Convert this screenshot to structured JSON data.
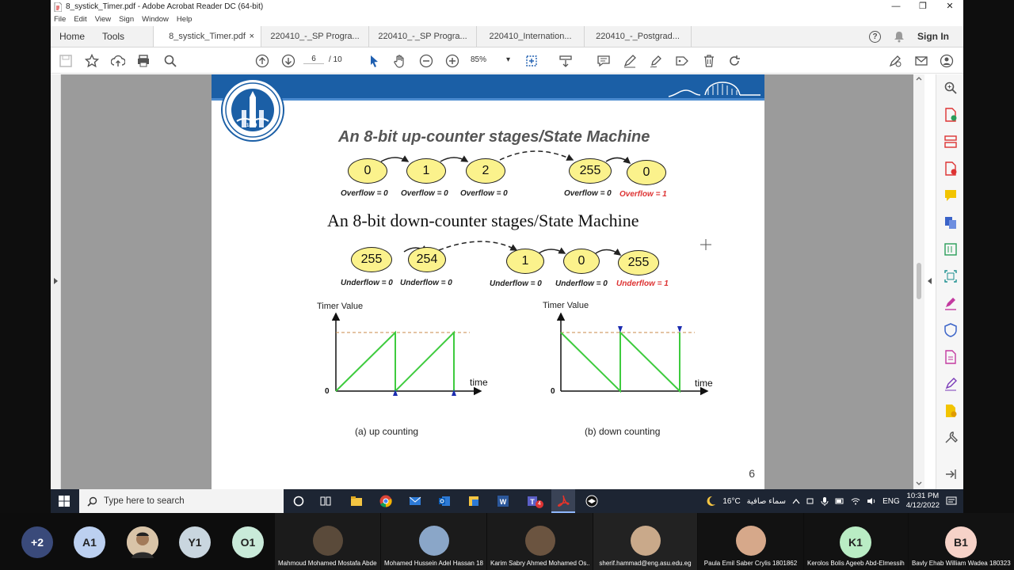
{
  "window": {
    "title": "8_systick_Timer.pdf - Adobe Acrobat Reader DC (64-bit)",
    "menu": [
      "File",
      "Edit",
      "View",
      "Sign",
      "Window",
      "Help"
    ]
  },
  "tabs": {
    "home": "Home",
    "tools": "Tools",
    "docs": [
      {
        "label": "8_systick_Timer.pdf"
      },
      {
        "label": "220410_-_SP Progra..."
      },
      {
        "label": "220410_-_SP Progra..."
      },
      {
        "label": "220410_Internation..."
      },
      {
        "label": "220410_-_Postgrad..."
      }
    ],
    "close": "×",
    "sign_in": "Sign In",
    "help": "?"
  },
  "toolbar": {
    "page_current": "6",
    "page_total": "/ 10",
    "zoom": "85%",
    "zoom_caret": "▾"
  },
  "slide": {
    "up_title": "An 8-bit up-counter stages/State Machine",
    "up_states": [
      "0",
      "1",
      "2",
      "255",
      "0"
    ],
    "up_flags": [
      "Overflow = 0",
      "Overflow = 0",
      "Overflow = 0",
      "Overflow = 0",
      "Overflow = 1"
    ],
    "down_title": "An 8-bit down-counter stages/State Machine",
    "down_states": [
      "255",
      "254",
      "1",
      "0",
      "255"
    ],
    "down_flags": [
      "Underflow = 0",
      "Underflow = 0",
      "Underflow = 0",
      "Underflow = 0",
      "Underflow = 1"
    ],
    "logo_year": "1839",
    "page_number": "6",
    "charts": [
      {
        "ylabel": "Timer Value",
        "zero": "0",
        "xlabel": "time",
        "caption": "(a) up counting"
      },
      {
        "ylabel": "Timer Value",
        "zero": "0",
        "xlabel": "time",
        "caption": "(b) down counting"
      }
    ]
  },
  "taskbar": {
    "search_placeholder": "Type here to search",
    "teams_badge": "4",
    "weather": "16°C",
    "weather_text": "سماء صافية",
    "lang": "ENG",
    "time": "10:31 PM",
    "date": "4/12/2022"
  },
  "meeting": {
    "avatars": [
      {
        "initials": "+2",
        "color": "#3a4a7a"
      },
      {
        "initials": "A1",
        "color": "#bcd0f0"
      },
      {
        "initials": "Y1",
        "color": "#c9d6df"
      },
      {
        "initials": "O1",
        "color": "#c9ead9"
      },
      {
        "initials": "K1",
        "color": "#b9ecc4"
      },
      {
        "initials": "B1",
        "color": "#f6d2c8"
      }
    ],
    "participants": [
      "Mahmoud Mohamed Mostafa Abde...",
      "Mohamed Hussein Adel Hassan 180...",
      "Karim Sabry Ahmed Mohamed Os...",
      "sherif.hammad@eng.asu.edu.eg",
      "Paula Emil Saber Crylis 1801862",
      "Kerolos Bolis Ageeb Abd-Elmessih 1...",
      "Bavly Ehab William Wadea 1803239"
    ]
  }
}
